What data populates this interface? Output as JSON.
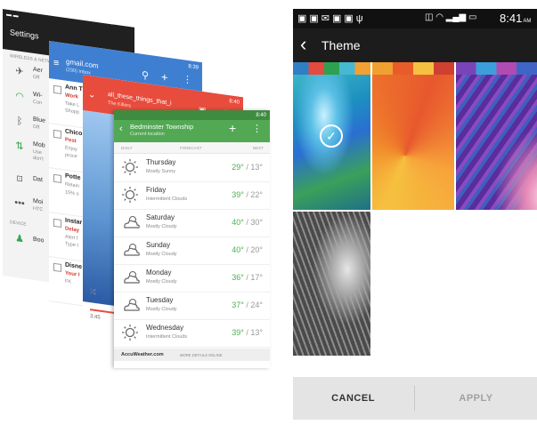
{
  "settings": {
    "title": "Settings",
    "section_wireless": "WIRELESS & NETW",
    "items": [
      {
        "title": "Aer",
        "sub": "Off",
        "icon": "airplane-icon"
      },
      {
        "title": "Wi-",
        "sub": "Con",
        "icon": "wifi-icon"
      },
      {
        "title": "Blue",
        "sub": "Off",
        "icon": "bluetooth-icon"
      },
      {
        "title": "Mob",
        "sub": "Use",
        "sub2": "don't",
        "icon": "mobile-data-icon"
      },
      {
        "title": "Dat",
        "sub": "",
        "icon": "data-usage-icon"
      },
      {
        "title": "Moi",
        "sub": "HTC",
        "icon": "more-icon"
      }
    ],
    "section_device": "DEVICE",
    "device_item": "Boo"
  },
  "gmail": {
    "status_time": "8:39",
    "account": "gmail.com",
    "inbox": "(230) Inbox",
    "mails": [
      {
        "from": "Ann T",
        "subject": "Work",
        "preview": "Take L",
        "preview2": "Shopp"
      },
      {
        "from": "Chico",
        "subject": "Pest",
        "preview": "Enjoy",
        "preview2": "proce"
      },
      {
        "from": "Potte",
        "subject": "",
        "preview": "Retain",
        "preview2": "15% o"
      },
      {
        "from": "Instar",
        "subject": "Delay",
        "preview": "Alert f",
        "preview2": "Type t"
      },
      {
        "from": "Disne",
        "subject": "Your I",
        "preview": "FK",
        "preview2": ""
      }
    ]
  },
  "music": {
    "status_time": "8:40",
    "track": "all_these_things_that_i",
    "artist": "The Killers",
    "time": "3:45"
  },
  "weather": {
    "status_time": "8:40",
    "location": "Bedminster Township",
    "location_sub": "Current location",
    "col_left": "DAILY",
    "col_mid": "FORECAST",
    "col_right": "NEXT",
    "days": [
      {
        "day": "Thursday",
        "cond": "Mostly Sunny",
        "hi": "29°",
        "lo": "13°",
        "icon": "sun-icon"
      },
      {
        "day": "Friday",
        "cond": "Intermittent Clouds",
        "hi": "39°",
        "lo": "22°",
        "icon": "sun-icon"
      },
      {
        "day": "Saturday",
        "cond": "Mostly Cloudy",
        "hi": "40°",
        "lo": "30°",
        "icon": "cloud-icon"
      },
      {
        "day": "Sunday",
        "cond": "Mostly Cloudy",
        "hi": "40°",
        "lo": "20°",
        "icon": "cloud-icon"
      },
      {
        "day": "Monday",
        "cond": "Mostly Cloudy",
        "hi": "36°",
        "lo": "17°",
        "icon": "cloud-icon"
      },
      {
        "day": "Tuesday",
        "cond": "Mostly Cloudy",
        "hi": "37°",
        "lo": "24°",
        "icon": "cloud-icon"
      },
      {
        "day": "Wednesday",
        "cond": "Intermittent Clouds",
        "hi": "39°",
        "lo": "13°",
        "icon": "sun-icon"
      }
    ],
    "footer_brand": "AccuWeather.com",
    "footer_link": "MORE DETAILS ONLINE"
  },
  "theme": {
    "status_time": "8:41",
    "status_am": "AM",
    "title": "Theme",
    "cancel": "CANCEL",
    "apply": "APPLY"
  },
  "colors": {
    "weather_green": "#52a853",
    "gmail_blue": "#3e7fd1",
    "music_red": "#e84c3d"
  }
}
